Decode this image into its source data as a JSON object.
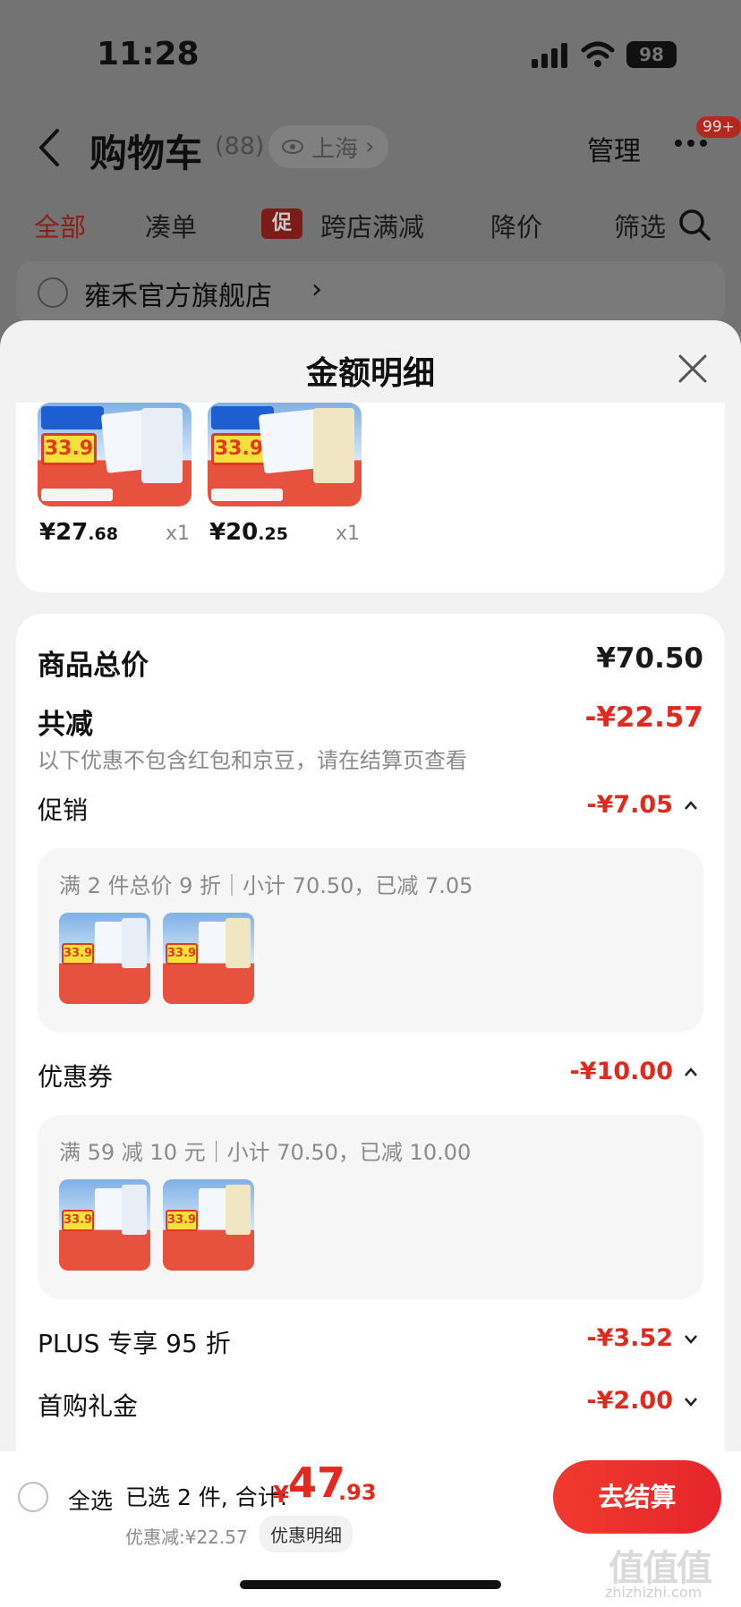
{
  "status": {
    "time": "11:28",
    "battery": "98"
  },
  "nav": {
    "title": "购物车",
    "count": "(88)",
    "location": "上海",
    "location_chevron": "›",
    "manage": "管理",
    "badge": "99+"
  },
  "filters": {
    "all": "全部",
    "combine": "凑单",
    "promo_tag": "促",
    "cross_store": "跨店满减",
    "price_drop": "降价",
    "filter": "筛选"
  },
  "store": {
    "name": "雍禾官方旗舰店",
    "chevron": "›"
  },
  "sheet": {
    "title": "金额明细"
  },
  "products": [
    {
      "price_int": "¥27",
      "price_dec": ".68",
      "qty": "x1",
      "badge": "33.9"
    },
    {
      "price_int": "¥20",
      "price_dec": ".25",
      "qty": "x1",
      "badge": "33.9"
    }
  ],
  "summary": {
    "total_label": "商品总价",
    "total_value": "¥70.50",
    "reduce_label": "共减",
    "reduce_value": "-¥22.57",
    "reduce_note": "以下优惠不包含红包和京豆，请在结算页查看",
    "promo_label": "促销",
    "promo_value": "-¥7.05",
    "promo_detail": "满 2 件总价 9 折｜小计 70.50，已减 7.05",
    "coupon_label": "优惠券",
    "coupon_value": "-¥10.00",
    "coupon_detail": "满 59 减 10 元｜小计 70.50，已减 10.00",
    "plus_label": "PLUS 专享 95 折",
    "plus_value": "-¥3.52",
    "first_label": "首购礼金",
    "first_value": "-¥2.00"
  },
  "bottom": {
    "select_all": "全选",
    "selected": "已选 2 件, 合计:",
    "total_yen": "¥",
    "total_int": "47",
    "total_dec": ".93",
    "discount": "优惠减:¥22.57",
    "detail_link": "优惠明细",
    "checkout": "去结算"
  },
  "watermark": {
    "text": "值值值",
    "sub": "zhizhizhi.com"
  },
  "colors": {
    "accent_red": "#e0291f",
    "sheet_bg": "#f2f2f2"
  }
}
